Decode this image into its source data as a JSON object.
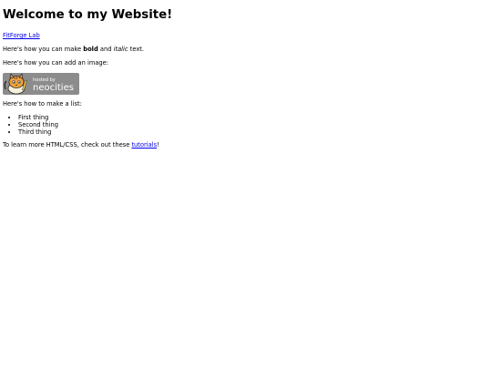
{
  "heading": "Welcome to my Website!",
  "site_link": "FitForge Lab",
  "formatting": {
    "prefix": "Here's how you can make ",
    "bold": "bold",
    "middle": " and ",
    "italic": "italic",
    "suffix": " text."
  },
  "image_intro": "Here's how you can add an image:",
  "badge": {
    "small_text": "hosted by",
    "big_text": "neocities",
    "icon": "neocities-cat-logo"
  },
  "list_intro": "Here's how to make a list:",
  "list_items": [
    "First thing",
    "Second thing",
    "Third thing"
  ],
  "learn": {
    "prefix": "To learn more HTML/CSS, check out these ",
    "link": "tutorials",
    "suffix": "!"
  },
  "colors": {
    "link": "#0000ee",
    "badge_bg": "#8c8c8c"
  }
}
